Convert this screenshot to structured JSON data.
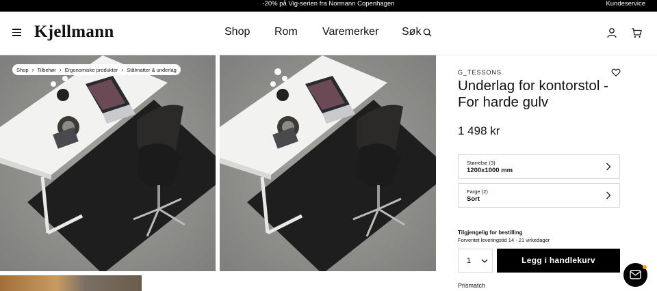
{
  "topbar": {
    "promo": "-20% på Vig-serien fra Normann Copenhagen",
    "service": "Kundeservice"
  },
  "header": {
    "logo": "Kjellmann",
    "nav": {
      "shop": "Shop",
      "rom": "Rom",
      "brands": "Varemerker",
      "search": "Søk"
    }
  },
  "breadcrumb": [
    "Shop",
    "Tilbehør",
    "Ergonomiske produkter",
    "Stålmatter & underlag"
  ],
  "product": {
    "brand": "G_TESSONS",
    "title": "Underlag for kontorstol - For harde gulv",
    "price": "1 498 kr",
    "size": {
      "label": "Størrelse (3)",
      "value": "1200x1000 mm"
    },
    "color": {
      "label": "Farge (2)",
      "value": "Sort"
    },
    "availability": "Tilgjengelig for bestilling",
    "delivery": "Forventet leveringstid 14 - 21 virkedager",
    "quantity": "1",
    "add_to_cart": "Legg i handlekurv",
    "price_match": "Prismatch"
  },
  "icons": {
    "menu": "hamburger-icon",
    "search": "search-icon",
    "account": "user-icon",
    "cart": "cart-icon",
    "wishlist": "heart-icon",
    "chat": "chat-icon"
  },
  "colors": {
    "button": "#000000",
    "chat_badge": "#f2a51f"
  }
}
